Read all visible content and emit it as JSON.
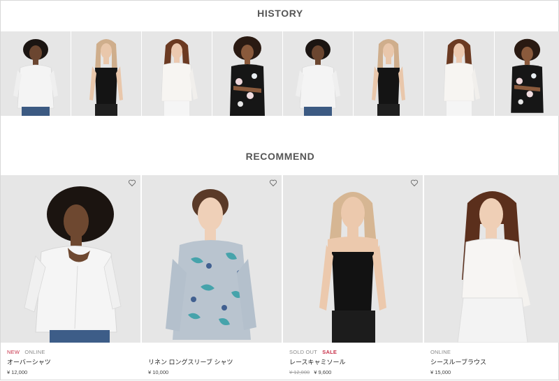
{
  "history": {
    "title": "HISTORY",
    "items": [
      {
        "model": "curly-dark-hair-white-shirt"
      },
      {
        "model": "blonde-black-camisole"
      },
      {
        "model": "auburn-white-blouse"
      },
      {
        "model": "curly-hair-floral-black-top"
      },
      {
        "model": "curly-dark-hair-white-shirt"
      },
      {
        "model": "blonde-black-camisole"
      },
      {
        "model": "auburn-white-blouse"
      },
      {
        "model": "curly-hair-floral-black-top"
      }
    ]
  },
  "recommend": {
    "title": "RECOMMEND",
    "items": [
      {
        "badges": [
          "NEW",
          "ONLINE"
        ],
        "name": "オーバーシャツ",
        "price": "¥ 12,000",
        "old_price": ""
      },
      {
        "badges": [],
        "name": "リネン ロングスリーブ シャツ",
        "price": "¥ 10,000",
        "old_price": ""
      },
      {
        "badges": [
          "SOLD OUT",
          "SALE"
        ],
        "name": "レースキャミソール",
        "price": "¥ 9,600",
        "old_price": "¥ 12,000"
      },
      {
        "badges": [
          "ONLINE"
        ],
        "name": "シースルーブラウス",
        "price": "¥ 15,000",
        "old_price": ""
      }
    ]
  },
  "colors": {
    "accent": "#c8324a",
    "muted": "#8a8a8a",
    "tile_bg": "#e6e6e6"
  }
}
